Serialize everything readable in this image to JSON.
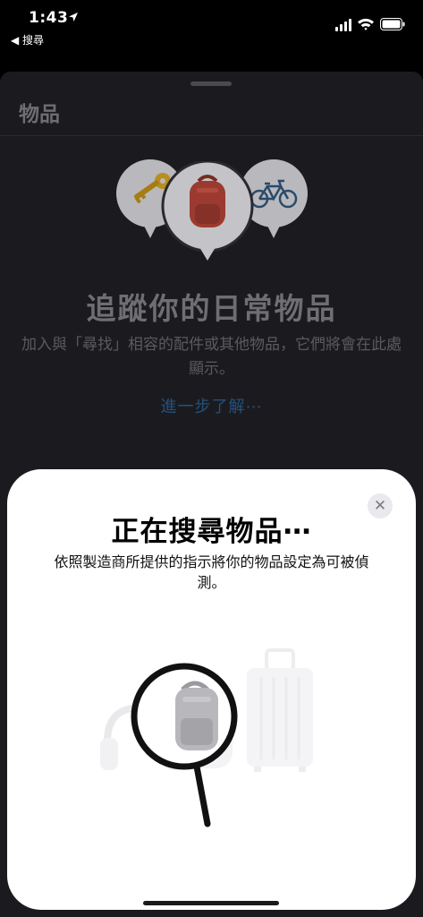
{
  "status_bar": {
    "time": "1:43",
    "back_label": "◀ 搜尋"
  },
  "background_sheet": {
    "title": "物品",
    "empty_title": "追蹤你的日常物品",
    "empty_description": "加入與「尋找」相容的配件或其他物品，它們將會在此處顯示。",
    "learn_more": "進一步了解⋯"
  },
  "modal": {
    "close_label": "✕",
    "title": "正在搜尋物品⋯",
    "description": "依照製造商所提供的指示將你的物品設定為可被偵測。"
  },
  "colors": {
    "accent_link": "#24507d",
    "modal_background": "#ffffff",
    "sheet_background": "#1b1b1f"
  }
}
